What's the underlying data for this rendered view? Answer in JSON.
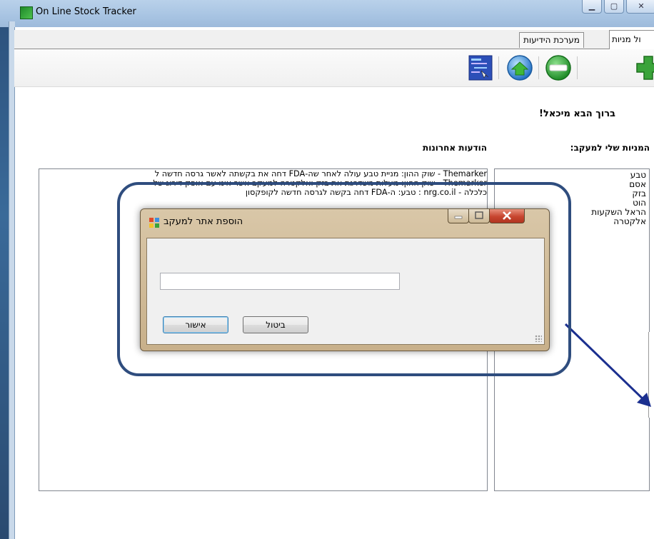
{
  "window": {
    "title": "On Line Stock Tracker",
    "controls": [
      "minimize",
      "maximize",
      "close"
    ]
  },
  "tabs": [
    {
      "label": "ניהול מניות",
      "display": "ול מניות",
      "active": true
    },
    {
      "label": "מערכת הידיעות",
      "active": false
    }
  ],
  "toolbar": {
    "icons": [
      "add-icon",
      "remove-icon",
      "refresh-globe-icon",
      "report-image-icon"
    ]
  },
  "main": {
    "welcome": "ברוך הבא מיכאל!",
    "stocks_label": "המניות שלי למעקב:",
    "news_label": "הודעות אחרונות",
    "stocks": [
      "טבע",
      "אסם",
      "בזק",
      "הוט",
      "הראל השקעות",
      "אלקטרה"
    ],
    "news": [
      "Themarker - שוק ההון: מניית טבע עולה לאחר שה-FDA דחה את בקשתה לאשר גרסה חדשה ל",
      "Themarker - שוק ההון: מעלות משדרגת את בזק ואלקטרה למעקב אשר אינו עם אופק דירוג של",
      "כלכלה - nrg.co.il : טבע: ה-FDA דחה בקשה לגרסה חדשה לקופקסון"
    ]
  },
  "dialog": {
    "title": "הוספת אתר למעקב",
    "input_value": "",
    "ok_label": "אישור",
    "cancel_label": "ביטול"
  },
  "colors": {
    "titlebar": "#a9c5e3",
    "callout_border": "#2f4d7e",
    "arrow": "#1b2f8f",
    "dialog_frame": "#c8b08a",
    "dialog_close": "#c7452f"
  }
}
